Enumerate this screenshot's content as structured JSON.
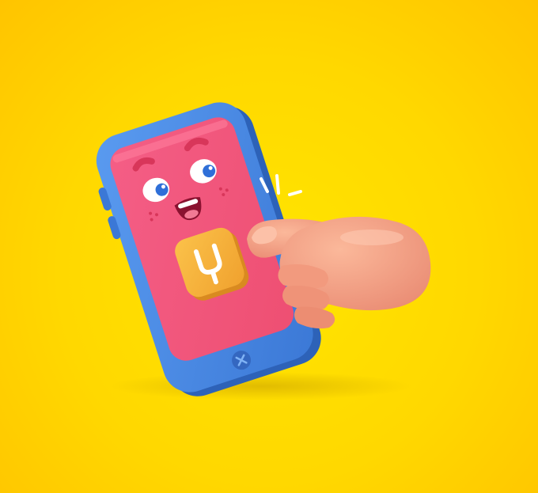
{
  "scene": {
    "description_tags": [
      "phone-character",
      "hand-pointer",
      "app-icon"
    ],
    "colors": {
      "background": "#ffdb00",
      "phone_frame": "#4c8ee8",
      "phone_screen": "#f2567a",
      "app_icon": "#f7b23a",
      "hand": "#f7a488",
      "eye_iris": "#2f6fd8"
    },
    "icons": {
      "app_icon_glyph": "tuning-fork-icon",
      "home_button_glyph": "close-icon"
    }
  }
}
